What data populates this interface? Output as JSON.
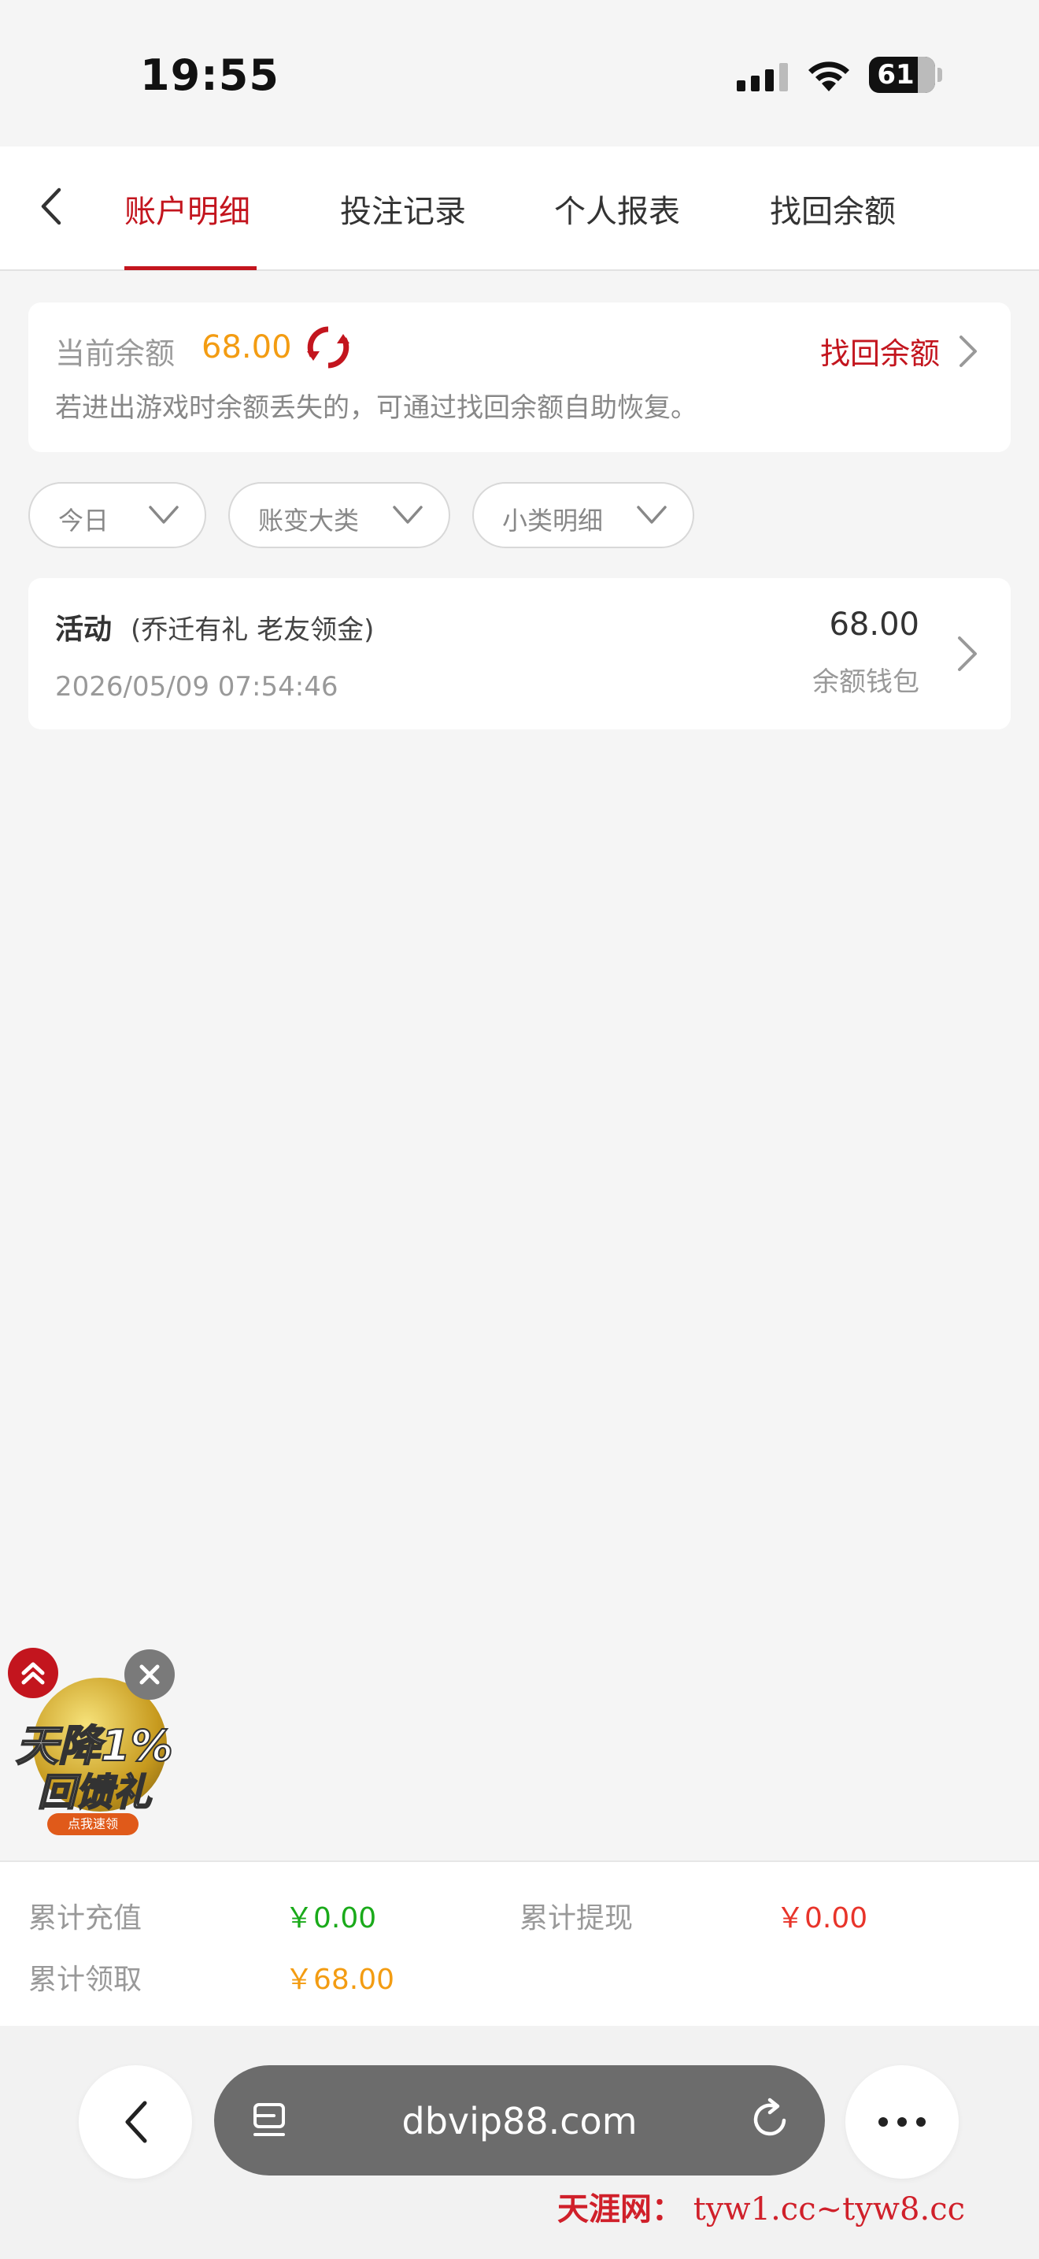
{
  "status_bar": {
    "time": "19:55",
    "battery": "61"
  },
  "tabs": [
    {
      "label": "账户明细",
      "active": true
    },
    {
      "label": "投注记录",
      "active": false
    },
    {
      "label": "个人报表",
      "active": false
    },
    {
      "label": "找回余额",
      "active": false
    }
  ],
  "balance": {
    "label": "当前余额",
    "value": "68.00",
    "recover_label": "找回余额",
    "hint": "若进出游戏时余额丢失的，可通过找回余额自助恢复。"
  },
  "filters": [
    {
      "label": "今日"
    },
    {
      "label": "账变大类"
    },
    {
      "label": "小类明细"
    }
  ],
  "records": [
    {
      "title": "活动",
      "subtitle": "(乔迁有礼 老友领金)",
      "time": "2026/05/09 07:54:46",
      "amount": "68.00",
      "wallet": "余额钱包"
    }
  ],
  "ad": {
    "line1": "天降1%",
    "line2": "回馈礼",
    "button": "点我速领"
  },
  "summary": {
    "recharge_label": "累计充值",
    "recharge_value": "￥0.00",
    "withdraw_label": "累计提现",
    "withdraw_value": "￥0.00",
    "claim_label": "累计领取",
    "claim_value": "￥68.00"
  },
  "browser": {
    "url": "dbvip88.com"
  },
  "watermark": {
    "brand": "天涯网：",
    "urls": "tyw1.cc~tyw8.cc"
  },
  "colors": {
    "accent": "#c3151e",
    "balance": "#f39c12",
    "green": "#1aaa1a",
    "red": "#e8342a"
  }
}
